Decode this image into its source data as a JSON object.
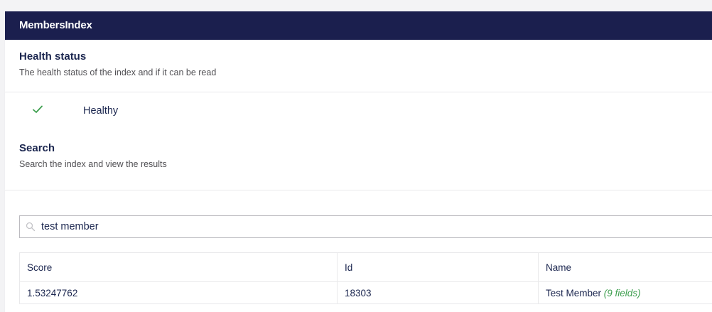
{
  "panel": {
    "title": "MembersIndex"
  },
  "health": {
    "title": "Health status",
    "description": "The health status of the index and if it can be read",
    "status_icon": "check-icon",
    "status_label": "Healthy"
  },
  "search": {
    "title": "Search",
    "description": "Search the index and view the results",
    "input_value": "test member",
    "icon": "search-icon"
  },
  "results": {
    "columns": [
      "Score",
      "Id",
      "Name"
    ],
    "rows": [
      {
        "score": "1.53247762",
        "id": "18303",
        "name": "Test Member",
        "fields": "(9 fields)"
      }
    ]
  },
  "colors": {
    "header_bg": "#1b1f4e",
    "success": "#3e9f4f",
    "text": "#1b264f"
  }
}
